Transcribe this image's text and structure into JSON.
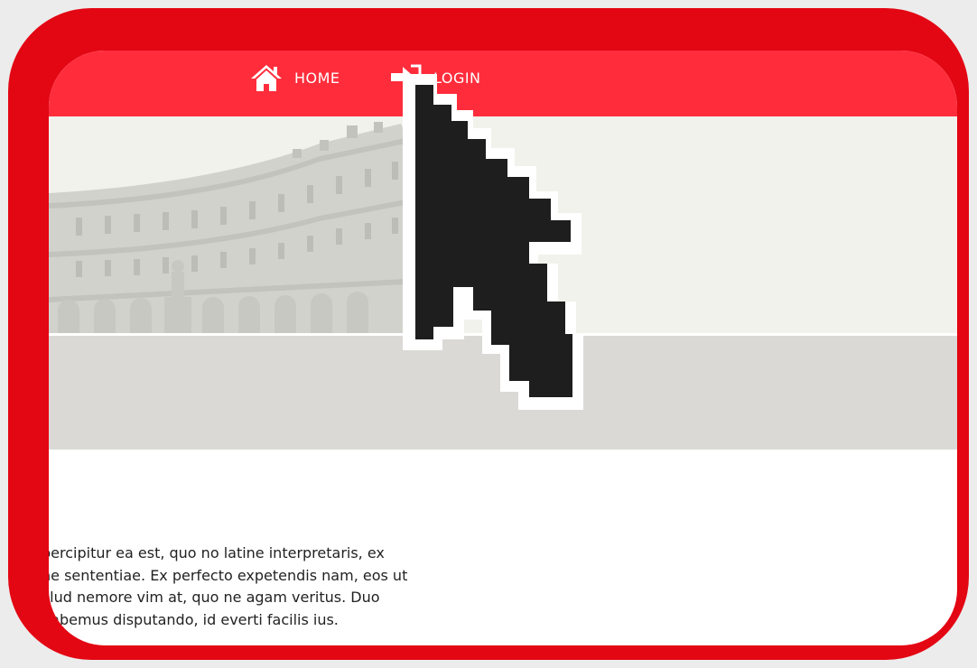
{
  "nav": {
    "home_label": "HOME",
    "login_label": "LOGIN"
  },
  "content": {
    "lines": [
      "percipitur ea est, quo no latine interpretaris, ex",
      "ne sententiae. Ex perfecto expetendis nam, eos ut",
      "Illud nemore vim at, quo ne agam veritus. Duo",
      "habemus disputando, id everti facilis ius."
    ]
  },
  "colors": {
    "frame": "#e30613",
    "navbar": "#ff2d3c",
    "hero": "#f2f2ec",
    "band": "#dad9d5",
    "cursor": "#1e1e1e"
  },
  "icons": {
    "home": "home-icon",
    "login": "login-icon",
    "cursor": "mouse-pointer-icon"
  }
}
